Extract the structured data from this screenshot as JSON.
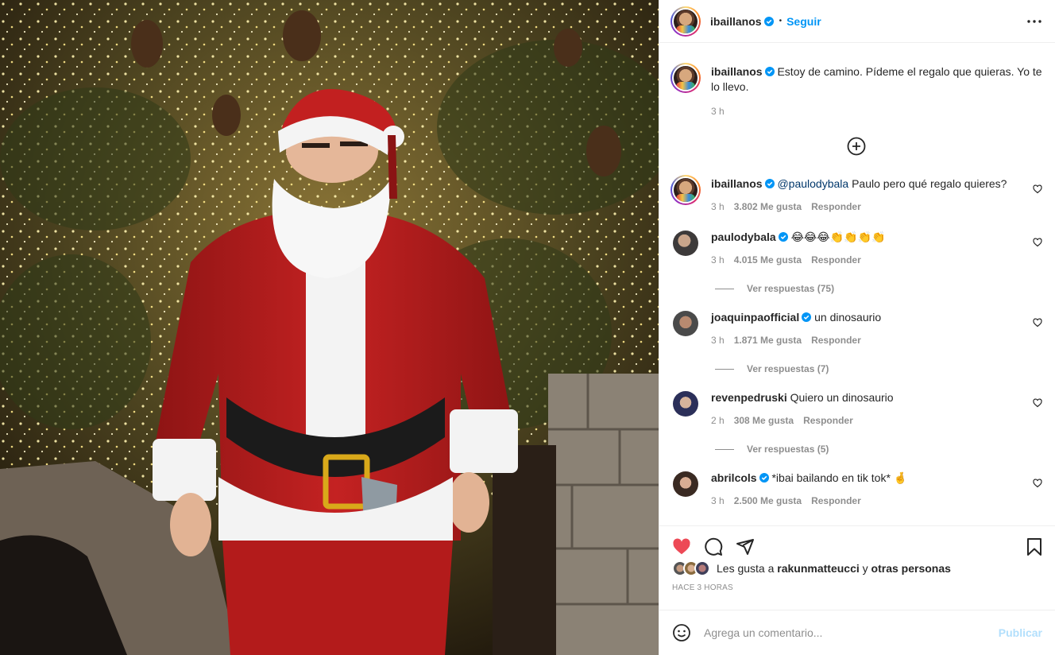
{
  "post_author": {
    "username": "ibaillanos",
    "follow_label": "Seguir",
    "separator": "•"
  },
  "caption": {
    "username": "ibaillanos",
    "text": "Estoy de camino. Pídeme el regalo que quieras. Yo te lo llevo.",
    "time": "3 h"
  },
  "comments": [
    {
      "username": "ibaillanos",
      "verified": true,
      "mention": "@paulodybala",
      "text": "Paulo pero qué regalo quieres?",
      "time": "3 h",
      "likes": "3.802 Me gusta",
      "reply": "Responder"
    },
    {
      "username": "paulodybala",
      "verified": true,
      "text": "😂😂😂👏👏👏👏",
      "time": "3 h",
      "likes": "4.015 Me gusta",
      "reply": "Responder",
      "replies": "Ver respuestas (75)"
    },
    {
      "username": "joaquinpaofficial",
      "verified": true,
      "text": "un dinosaurio",
      "time": "3 h",
      "likes": "1.871 Me gusta",
      "reply": "Responder",
      "replies": "Ver respuestas (7)"
    },
    {
      "username": "revenpedruski",
      "verified": false,
      "text": "Quiero un dinosaurio",
      "time": "2 h",
      "likes": "308 Me gusta",
      "reply": "Responder",
      "replies": "Ver respuestas (5)"
    },
    {
      "username": "abrilcols",
      "verified": true,
      "text": "*ibai bailando en tik tok* 🤞",
      "time": "3 h",
      "likes": "2.500 Me gusta",
      "reply": "Responder"
    }
  ],
  "likes_summary": {
    "prefix": "Les gusta a",
    "user": "rakunmatteucci",
    "joiner": "y",
    "others": "otras personas"
  },
  "timestamp": "HACE 3 HORAS",
  "add_comment": {
    "placeholder": "Agrega un comentario...",
    "publish_label": "Publicar"
  },
  "colors": {
    "link_blue": "#0095f6",
    "like_red": "#ed4956",
    "verified_blue": "#0095f6",
    "secondary_text": "#8e8e8e"
  },
  "icons": [
    "more-options-icon",
    "verified-badge-icon",
    "add-circle-icon",
    "heart-icon",
    "comment-icon",
    "share-icon",
    "bookmark-icon",
    "emoji-icon"
  ]
}
